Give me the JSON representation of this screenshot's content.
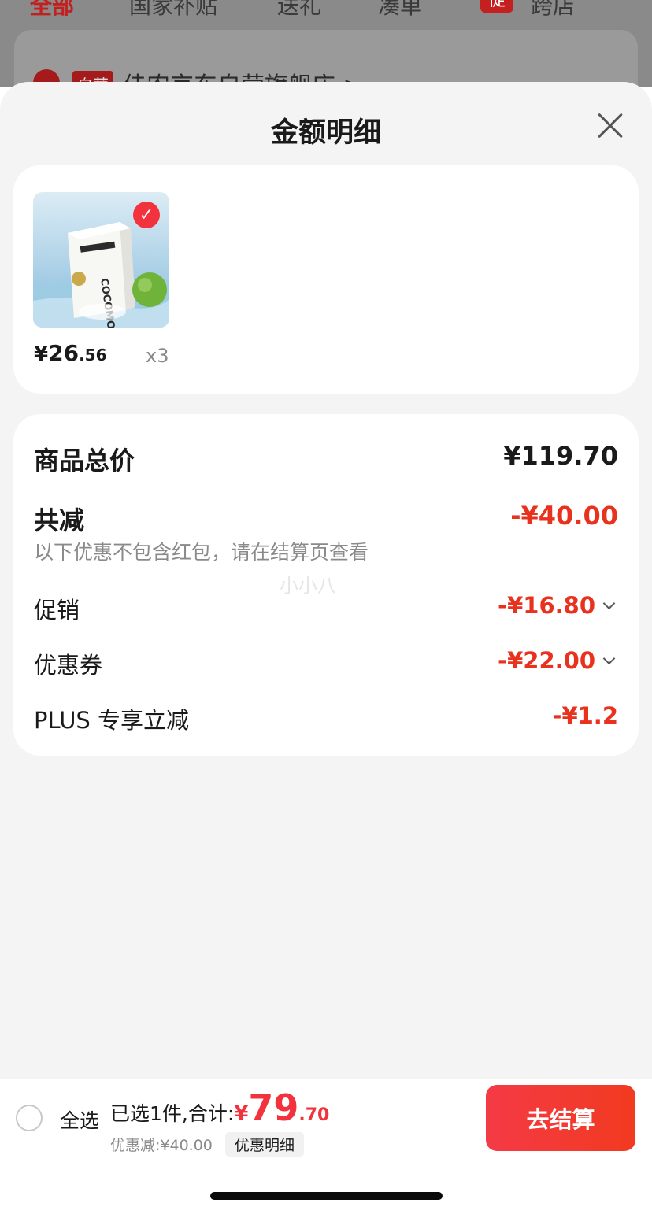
{
  "background": {
    "tabs": [
      "全部",
      "国家补贴",
      "送礼",
      "凑单",
      "跨店"
    ],
    "tab_badge": "促",
    "shop_tag": "自营",
    "shop_name": "佳农京东自营旗舰店 >"
  },
  "sheet": {
    "title": "金额明细",
    "product": {
      "price_symbol": "¥",
      "price_int": "26",
      "price_dec": ".56",
      "quantity": "x3",
      "image_text": "COCOMOMENT",
      "checked_icon": "check-icon"
    },
    "details": {
      "total_label": "商品总价",
      "total_value": "¥119.70",
      "reduction_label": "共减",
      "reduction_value": "-¥40.00",
      "note": "以下优惠不包含红包，请在结算页查看",
      "watermark": "小小八",
      "promo_label": "促销",
      "promo_value": "-¥16.80",
      "coupon_label": "优惠券",
      "coupon_value": "-¥22.00",
      "plus_label": "PLUS 专享立减",
      "plus_value": "-¥1.2"
    }
  },
  "bottom_bar": {
    "select_all": "全选",
    "selected_text": "已选1件,合计:",
    "price_symbol": "¥",
    "price_int": "79",
    "price_dec": ".70",
    "discount_text": "优惠减:¥40.00",
    "detail_link": "优惠明细",
    "checkout_button": "去结算"
  },
  "colors": {
    "accent_red": "#e8321e",
    "button_red": "#f23a3a",
    "sheet_bg": "#f4f4f4"
  }
}
